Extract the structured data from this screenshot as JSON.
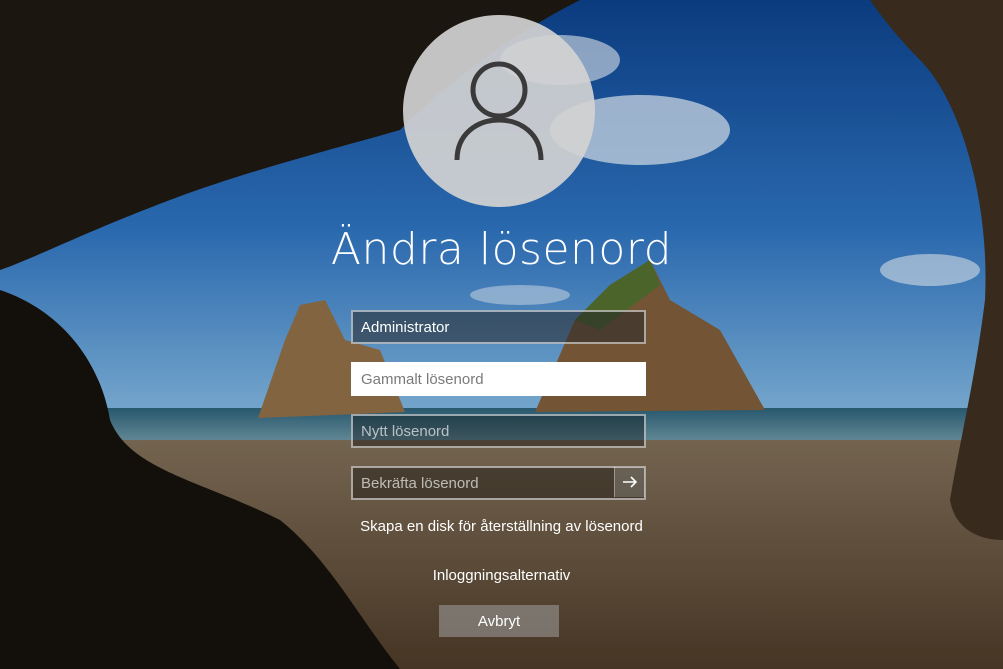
{
  "title": "Ändra lösenord",
  "fields": {
    "username_value": "Administrator",
    "old_password_placeholder": "Gammalt lösenord",
    "new_password_placeholder": "Nytt lösenord",
    "confirm_password_placeholder": "Bekräfta lösenord"
  },
  "links": {
    "reset_disk": "Skapa en disk för återställning av lösenord",
    "sign_in_options": "Inloggningsalternativ"
  },
  "buttons": {
    "cancel": "Avbryt",
    "submit_icon": "arrow-right-icon"
  },
  "avatar_icon": "user-silhouette-icon"
}
